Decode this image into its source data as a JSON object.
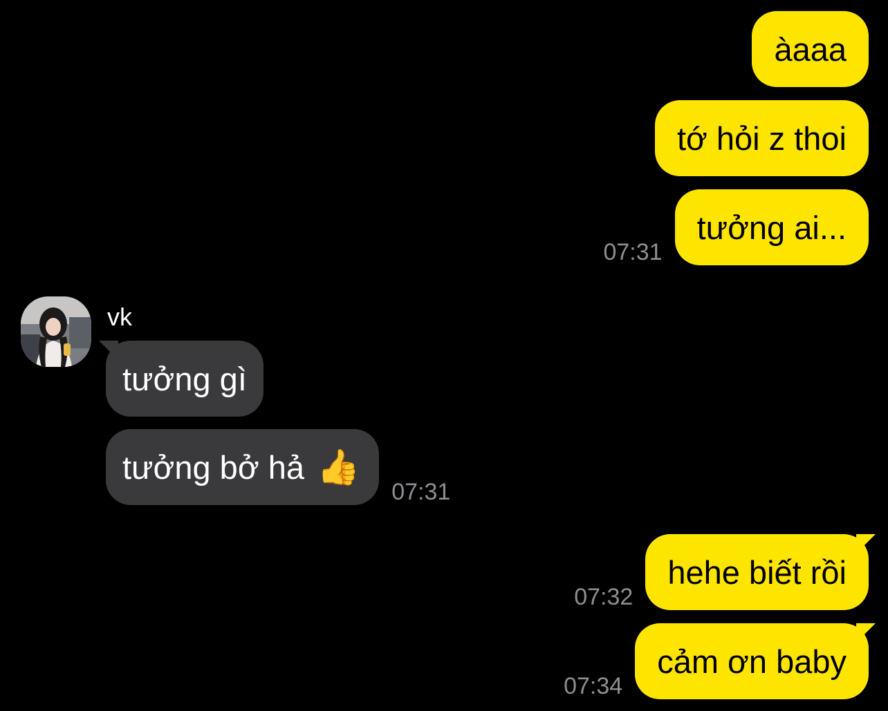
{
  "colors": {
    "background": "#000000",
    "outgoing_bubble": "#FEE500",
    "incoming_bubble": "#3A3A3C",
    "timestamp": "#8E8E93"
  },
  "contact": {
    "name": "vk",
    "avatar_icon": "profile-photo-icon"
  },
  "messages": [
    {
      "direction": "outgoing",
      "text": "àaaa",
      "time": ""
    },
    {
      "direction": "outgoing",
      "text": "tớ hỏi z thoi",
      "time": ""
    },
    {
      "direction": "outgoing",
      "text": "tưởng ai...",
      "time": "07:31"
    },
    {
      "direction": "incoming",
      "text": "tưởng gì",
      "time": ""
    },
    {
      "direction": "incoming",
      "text": "tưởng bở hả",
      "emoji": "thumbs-up-icon",
      "time": "07:31"
    },
    {
      "direction": "outgoing",
      "text": "hehe biết rồi",
      "time": "07:32"
    },
    {
      "direction": "outgoing",
      "text": "cảm ơn baby",
      "time": "07:34"
    }
  ]
}
